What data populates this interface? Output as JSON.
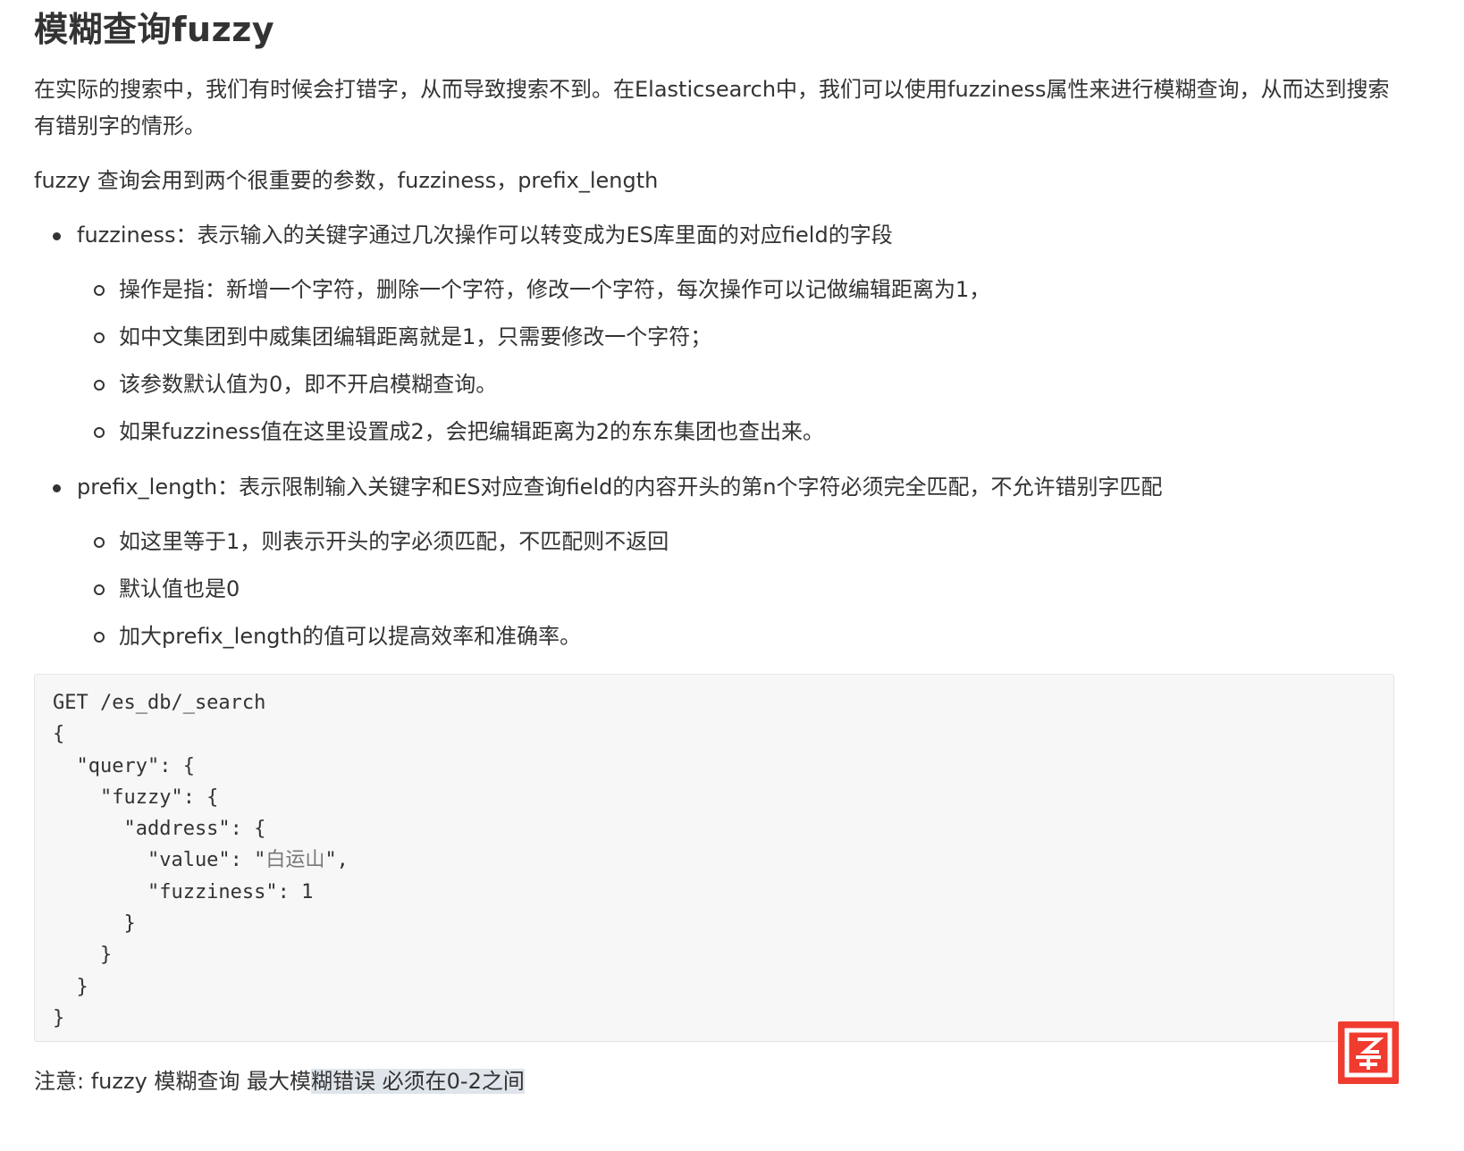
{
  "title": "模糊查询fuzzy",
  "intro": "在实际的搜索中，我们有时候会打错字，从而导致搜索不到。在Elasticsearch中，我们可以使用fuzziness属性来进行模糊查询，从而达到搜索有错别字的情形。",
  "params_line": "fuzzy 查询会用到两个很重要的参数，fuzziness，prefix_length",
  "bullets": [
    {
      "text": "fuzziness：表示输入的关键字通过几次操作可以转变成为ES库里面的对应field的字段",
      "subs": [
        "操作是指：新增一个字符，删除一个字符，修改一个字符，每次操作可以记做编辑距离为1，",
        "如中文集团到中威集团编辑距离就是1，只需要修改一个字符；",
        "该参数默认值为0，即不开启模糊查询。",
        "如果fuzziness值在这里设置成2，会把编辑距离为2的东东集团也查出来。"
      ]
    },
    {
      "text": "prefix_length：表示限制输入关键字和ES对应查询field的内容开头的第n个字符必须完全匹配，不允许错别字匹配",
      "subs": [
        "如这里等于1，则表示开头的字必须匹配，不匹配则不返回",
        "默认值也是0",
        "加大prefix_length的值可以提高效率和准确率。"
      ]
    }
  ],
  "code": {
    "lines": [
      "GET /es_db/_search",
      "{",
      "  \"query\": {",
      "    \"fuzzy\": {",
      "      \"address\": {",
      "        \"value\": \"",
      "        \"fuzziness\": 1",
      "      }",
      "    }",
      "  }",
      "}"
    ],
    "value_cn": "白运山",
    "value_suffix": "\","
  },
  "note": {
    "prefix": "注意: fuzzy 模糊查询 最大模",
    "highlighted": "糊错误 必须在0-2之间"
  },
  "stamp_icon": "red-stamp-logo-icon",
  "colors": {
    "text": "#333333",
    "code_bg": "#f7f7f7",
    "highlight": "#dfe5ea",
    "stamp": "#f03b2f"
  }
}
